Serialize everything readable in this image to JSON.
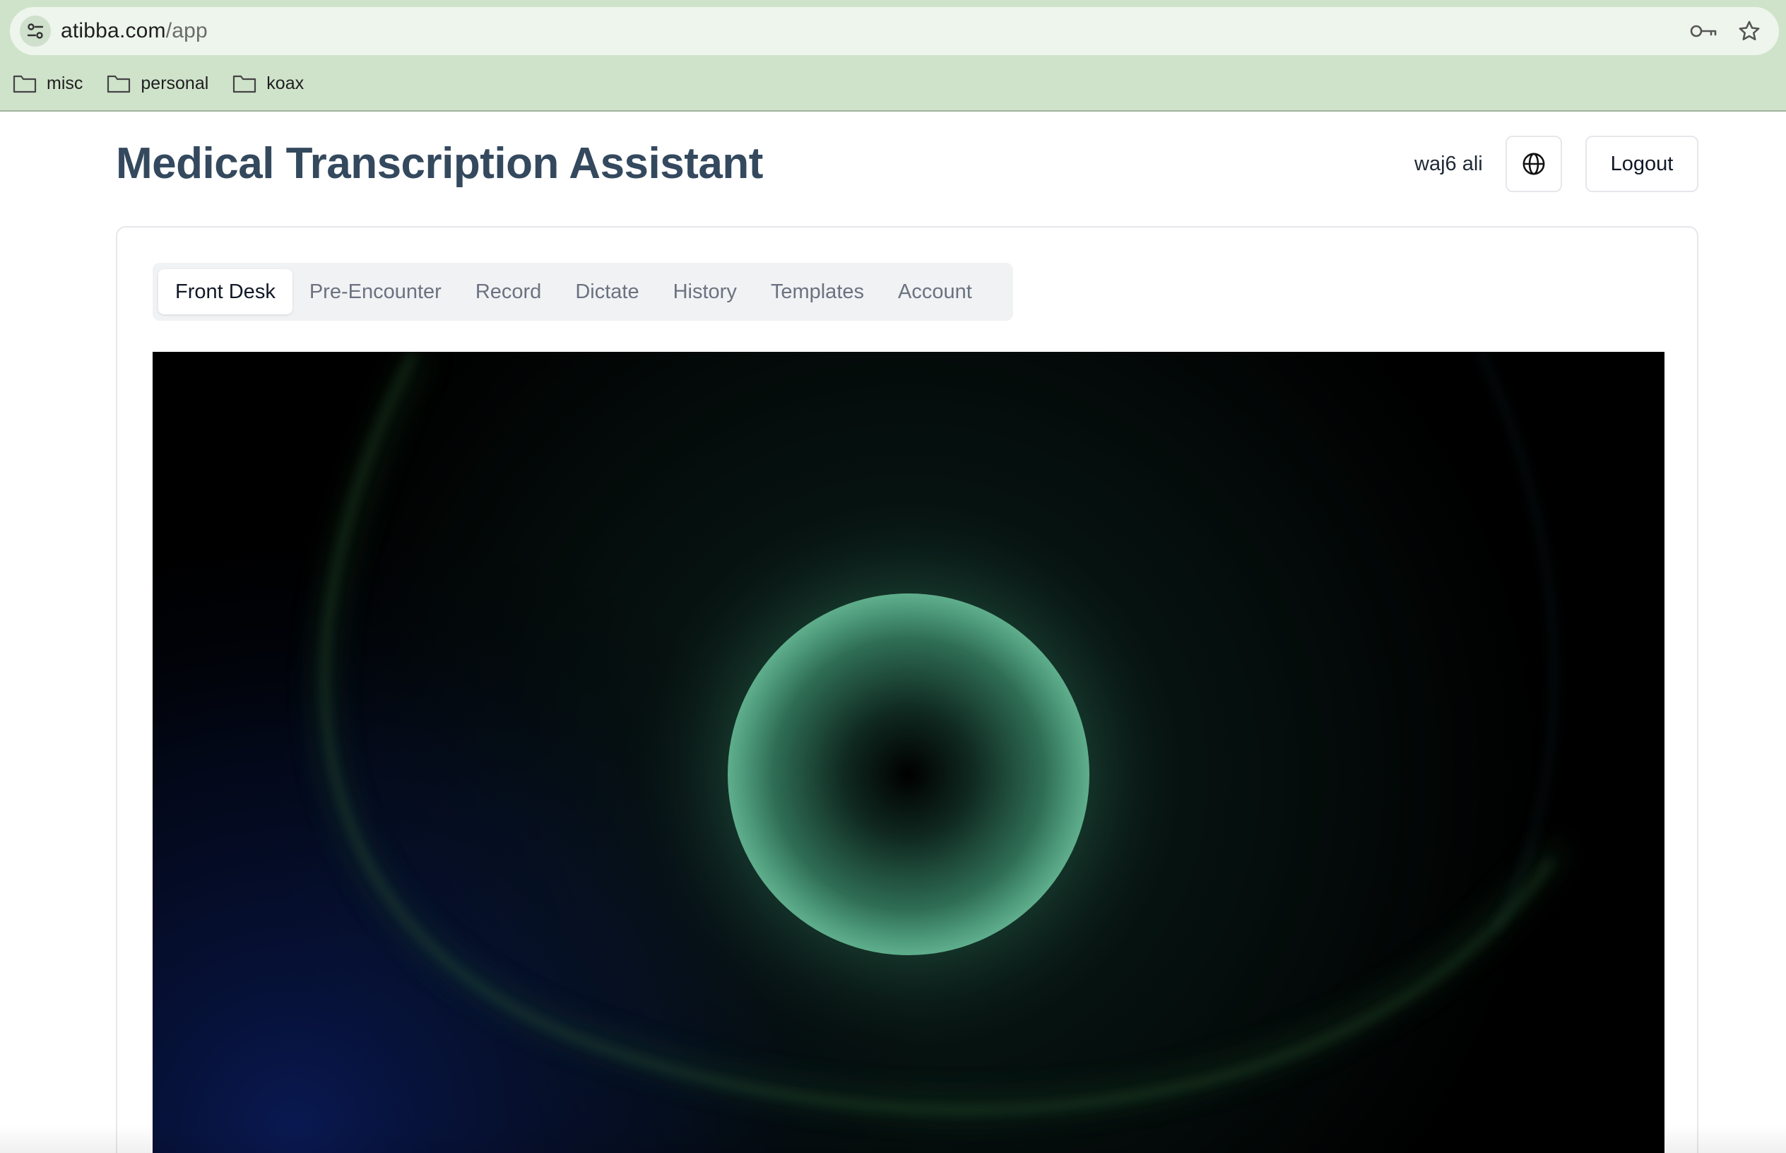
{
  "browser": {
    "url_domain": "atibba.com",
    "url_path": "/app",
    "icons": [
      "site-settings-icon",
      "password-key-icon",
      "bookmark-star-icon"
    ],
    "bookmarks": [
      {
        "label": "misc",
        "icon": "folder-icon"
      },
      {
        "label": "personal",
        "icon": "folder-icon"
      },
      {
        "label": "koax",
        "icon": "folder-icon"
      }
    ]
  },
  "header": {
    "title": "Medical Transcription Assistant",
    "username": "waj6 ali",
    "language_icon": "globe-icon",
    "logout_label": "Logout"
  },
  "tabs": [
    {
      "label": "Front Desk",
      "active": true
    },
    {
      "label": "Pre-Encounter",
      "active": false
    },
    {
      "label": "Record",
      "active": false
    },
    {
      "label": "Dictate",
      "active": false
    },
    {
      "label": "History",
      "active": false
    },
    {
      "label": "Templates",
      "active": false
    },
    {
      "label": "Account",
      "active": false
    }
  ],
  "visualizer": {
    "orb_color": "#5fae8c",
    "background_color": "#000000",
    "arc_color": "#2f6b3a"
  },
  "colors": {
    "title": "#34495e",
    "chrome_bg": "#cfe3cb",
    "tab_track": "#f1f2f4"
  }
}
